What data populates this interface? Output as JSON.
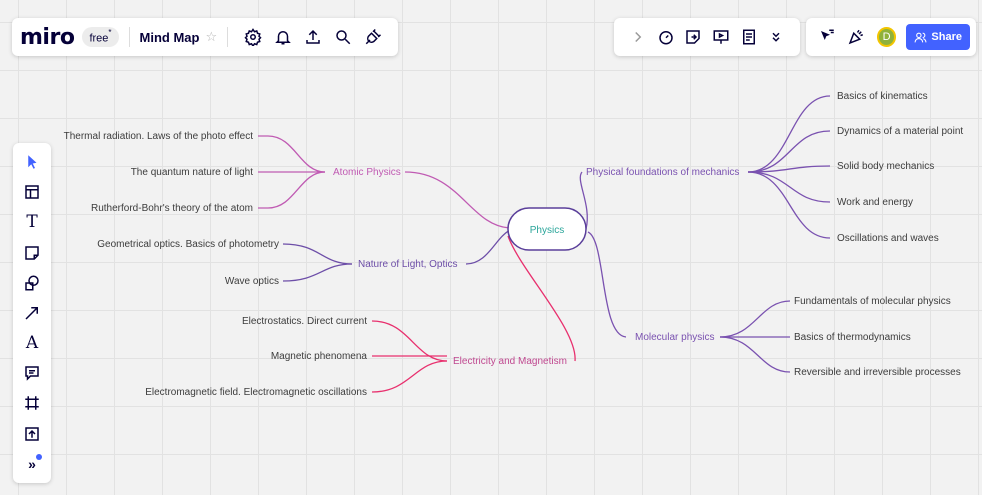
{
  "header": {
    "logo": "miro",
    "plan_badge": "free",
    "plan_badge_mark": "*",
    "board_title": "Mind Map"
  },
  "top_left_icons": [
    "settings-icon",
    "bell-icon",
    "upload-icon",
    "search-icon",
    "plugin-icon"
  ],
  "top_center_icons": [
    "chevron-right-icon",
    "timer-icon",
    "sticky-export-icon",
    "presentation-icon",
    "notes-icon",
    "chevron-double-down-icon"
  ],
  "top_right": {
    "avatar_initial": "D",
    "share_label": "Share"
  },
  "left_toolbar": {
    "text_tool_glyph": "T",
    "pen_tool_glyph": "A",
    "more_glyph": "»"
  },
  "colors": {
    "atomic": "#c05bb3",
    "optics": "#6d4ea8",
    "electricity": "#e8306e",
    "mechanics": "#7a52b0",
    "molecular": "#7a52b0",
    "root_border": "#5a3f9a",
    "root_text": "#2aa59a",
    "accent": "#4262ff"
  },
  "mindmap": {
    "root": "Physics",
    "left_branches": [
      {
        "label": "Atomic Physics",
        "children": [
          "Thermal radiation. Laws of the photo effect",
          "The quantum nature of light",
          "Rutherford-Bohr's theory of the atom"
        ]
      },
      {
        "label": "Nature of Light, Optics",
        "children": [
          "Geometrical optics. Basics of photometry",
          "Wave optics"
        ]
      },
      {
        "label": "Electricity and Magnetism",
        "children": [
          "Electrostatics. Direct current",
          "Magnetic phenomena",
          "Electromagnetic field. Electromagnetic oscillations"
        ]
      }
    ],
    "right_branches": [
      {
        "label": "Physical foundations of mechanics",
        "children": [
          "Basics of kinematics",
          "Dynamics of a material point",
          "Solid body mechanics",
          "Work and energy",
          "Oscillations and waves"
        ]
      },
      {
        "label": "Molecular physics",
        "children": [
          "Fundamentals of molecular physics",
          "Basics of thermodynamics",
          "Reversible and irreversible processes"
        ]
      }
    ]
  }
}
